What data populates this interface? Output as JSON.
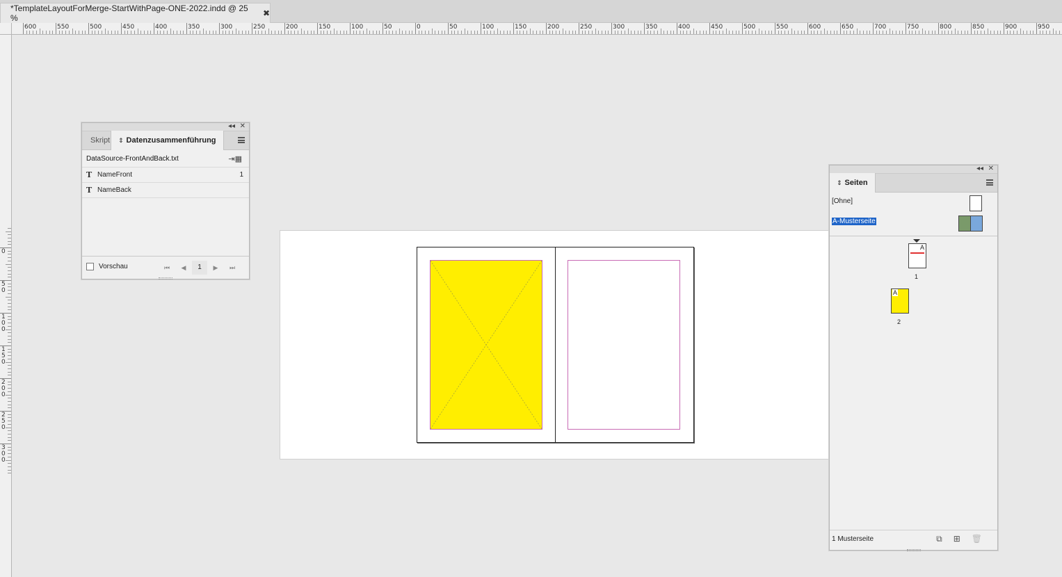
{
  "document": {
    "tab_title": "*TemplateLayoutForMerge-StartWithPage-ONE-2022.indd @ 25 %",
    "close_glyph": "✖"
  },
  "ruler": {
    "h_labels": [
      "600",
      "550",
      "500",
      "450",
      "400",
      "350",
      "300",
      "250",
      "200",
      "150",
      "100",
      "50",
      "0",
      "50",
      "100",
      "150",
      "200",
      "250",
      "300",
      "350",
      "400",
      "450",
      "500",
      "550",
      "600",
      "650",
      "700",
      "750",
      "800",
      "850",
      "900",
      "950"
    ],
    "v_labels": [
      "0",
      "50",
      "100",
      "150",
      "200",
      "250",
      "300"
    ]
  },
  "data_merge_panel": {
    "collapse_glyph": "◂◂",
    "close_glyph": "✕",
    "tab_inactive": "Skript",
    "tab_active": "Datenzusammenführung",
    "source_file": "DataSource-FrontAndBack.txt",
    "fields": [
      {
        "icon": "T",
        "name": "NameFront",
        "count": "1"
      },
      {
        "icon": "T",
        "name": "NameBack",
        "count": ""
      }
    ],
    "preview_label": "Vorschau",
    "record_number": "1",
    "nav_first": "⏮",
    "nav_prev": "◀",
    "nav_next": "▶",
    "nav_last": "⏭"
  },
  "pages_panel": {
    "collapse_glyph": "◂◂",
    "close_glyph": "✕",
    "tab_label": "Seiten",
    "masters": [
      {
        "label": "[Ohne]",
        "selected": false
      },
      {
        "label": "A-Musterseite",
        "selected": true
      }
    ],
    "master_colors": {
      "left": "#7a9a6a",
      "right": "#7aa8dc"
    },
    "pages": [
      {
        "number": "1",
        "prefix": "A"
      },
      {
        "number": "2",
        "prefix": "A"
      }
    ],
    "footer_text": "1 Musterseite"
  },
  "colors": {
    "frame_fill": "#ffee00",
    "frame_stroke": "#c86ab4",
    "selection": "#1e64c8"
  }
}
